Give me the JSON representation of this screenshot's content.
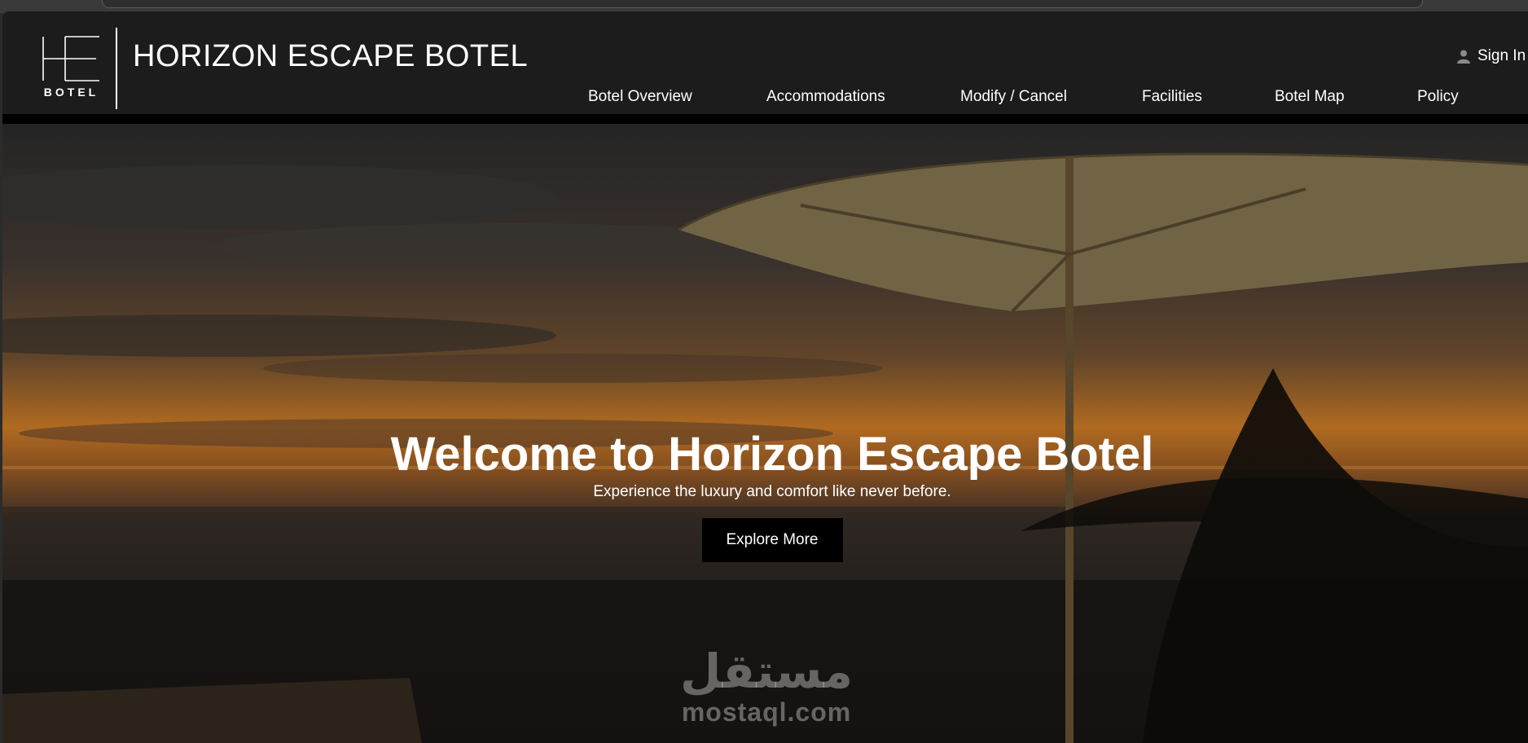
{
  "header": {
    "logo_monogram": "HE",
    "logo_subtext": "BOTEL",
    "brand_title": "HORIZON ESCAPE BOTEL",
    "signin_label": "Sign In",
    "signin_icon": "user-icon"
  },
  "nav": {
    "items": [
      {
        "label": "Botel Overview"
      },
      {
        "label": "Accommodations"
      },
      {
        "label": "Modify / Cancel"
      },
      {
        "label": "Facilities"
      },
      {
        "label": "Botel Map"
      },
      {
        "label": "Policy"
      }
    ]
  },
  "hero": {
    "title": "Welcome to Horizon Escape Botel",
    "subtitle": "Experience the luxury and comfort like never before.",
    "cta_label": "Explore More"
  },
  "watermark": {
    "arabic": "مستقل",
    "domain": "mostaql.com"
  },
  "colors": {
    "header_bg": "#1c1c1c",
    "button_bg": "#000000",
    "text": "#ffffff",
    "sunset_orange": "#d78228"
  }
}
